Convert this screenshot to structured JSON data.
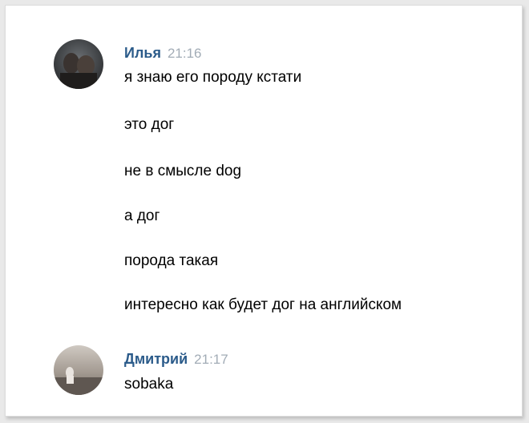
{
  "colors": {
    "author_name": "#2b5b8a",
    "timestamp": "#a2acb6",
    "message_text": "#000000",
    "background": "#ffffff"
  },
  "messages": [
    {
      "author": "Илья",
      "time": "21:16",
      "avatar": "user-photo-avatar",
      "lines": [
        "я знаю его породу кстати",
        "это дог",
        "не в смысле dog",
        "а дог",
        "порода такая",
        "интересно как будет дог на английском"
      ]
    },
    {
      "author": "Дмитрий",
      "time": "21:17",
      "avatar": "user-photo-avatar",
      "lines": [
        "sobaka"
      ]
    }
  ]
}
